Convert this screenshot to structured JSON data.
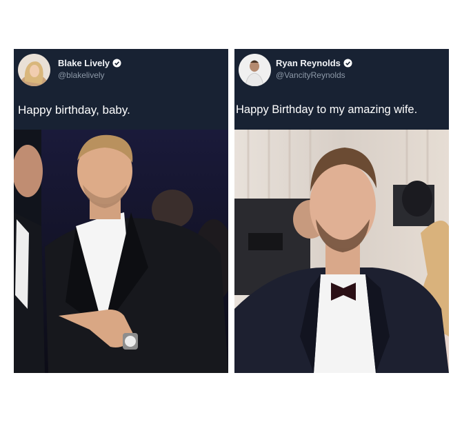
{
  "tweets": [
    {
      "name": "Blake Lively",
      "handle": "@blakelively",
      "text": "Happy birthday, baby."
    },
    {
      "name": "Ryan Reynolds",
      "handle": "@VancityReynolds",
      "text": "Happy Birthday to my amazing wife."
    }
  ],
  "colors": {
    "tweet_bg": "#182233",
    "verified": "#ffffff"
  }
}
